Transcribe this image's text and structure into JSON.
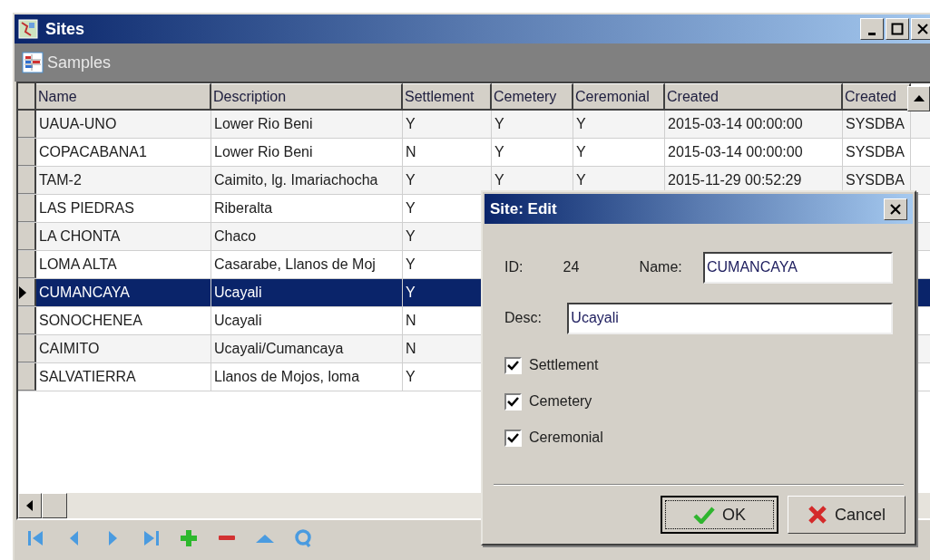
{
  "window": {
    "title": "Sites"
  },
  "toolbar": {
    "label": "Samples"
  },
  "table": {
    "columns": [
      "Name",
      "Description",
      "Settlement",
      "Cemetery",
      "Ceremonial",
      "Created",
      "Created"
    ],
    "rows": [
      {
        "selected": false,
        "cells": [
          "UAUA-UNO",
          "Lower Rio Beni",
          "Y",
          "Y",
          "Y",
          "2015-03-14 00:00:00",
          "SYSDBA"
        ]
      },
      {
        "selected": false,
        "cells": [
          "COPACABANA1",
          "Lower Rio Beni",
          "N",
          "Y",
          "Y",
          "2015-03-14 00:00:00",
          "SYSDBA"
        ]
      },
      {
        "selected": false,
        "cells": [
          "TAM-2",
          "Caimito, lg. Imariachocha",
          "Y",
          "Y",
          "Y",
          "2015-11-29 00:52:29",
          "SYSDBA"
        ]
      },
      {
        "selected": false,
        "cells": [
          "LAS PIEDRAS",
          "Riberalta",
          "Y"
        ]
      },
      {
        "selected": false,
        "cells": [
          "LA CHONTA",
          "Chaco",
          "Y"
        ]
      },
      {
        "selected": false,
        "cells": [
          "LOMA ALTA",
          "Casarabe, Llanos de Moj",
          "Y"
        ]
      },
      {
        "selected": true,
        "cells": [
          "CUMANCAYA",
          "Ucayali",
          "Y"
        ]
      },
      {
        "selected": false,
        "cells": [
          "SONOCHENEA",
          "Ucayali",
          "N"
        ]
      },
      {
        "selected": false,
        "cells": [
          "CAIMITO",
          "Ucayali/Cumancaya",
          "N"
        ]
      },
      {
        "selected": false,
        "cells": [
          "SALVATIERRA",
          "Llanos de Mojos, loma",
          "Y"
        ]
      }
    ]
  },
  "navigator": [
    {
      "kind": "first"
    },
    {
      "kind": "prior"
    },
    {
      "kind": "next"
    },
    {
      "kind": "last"
    },
    {
      "kind": "add"
    },
    {
      "kind": "delete"
    },
    {
      "kind": "edit"
    },
    {
      "kind": "refresh"
    }
  ],
  "dialog": {
    "title": "Site: Edit",
    "id_label": "ID:",
    "id_value": "24",
    "name_label": "Name:",
    "name_value": "CUMANCAYA",
    "desc_label": "Desc:",
    "desc_value": "Ucayali",
    "checkboxes": [
      {
        "label": "Settlement",
        "checked": true
      },
      {
        "label": "Cemetery",
        "checked": true
      },
      {
        "label": "Ceremonial",
        "checked": true
      }
    ],
    "buttons": [
      {
        "kind": "ok",
        "label": "OK"
      },
      {
        "kind": "cancel",
        "label": "Cancel"
      }
    ]
  }
}
